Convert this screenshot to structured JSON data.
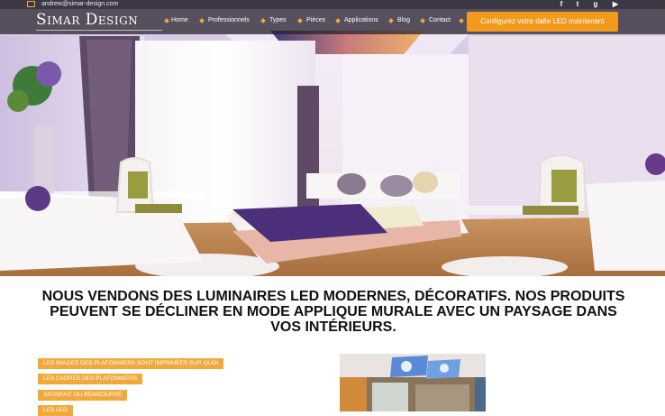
{
  "topbar": {
    "email": "andrew@simar-design.com",
    "social_icons": [
      "facebook-icon",
      "twitter-icon",
      "google-plus-icon",
      "youtube-icon"
    ]
  },
  "brand": {
    "logo_text": "Simar Design",
    "accent_color": "#f29a1e"
  },
  "nav": {
    "items": [
      "Home",
      "Professionnels",
      "Types",
      "Pièces",
      "Applications",
      "Blog",
      "Contact"
    ],
    "cta_label": "Configurez votre dalle LED maintenant"
  },
  "main": {
    "headline": "Nous vendons des luminaires LED modernes, décoratifs. Nos produits peuvent se décliner en mode applique murale avec un paysage dans vos intérieurs.",
    "tags": [
      "Les images des plafonniers sont imprimées sur quoi",
      "Les cadres des plafonniers",
      "Satisfait ou remboursé",
      "Les LED"
    ]
  }
}
